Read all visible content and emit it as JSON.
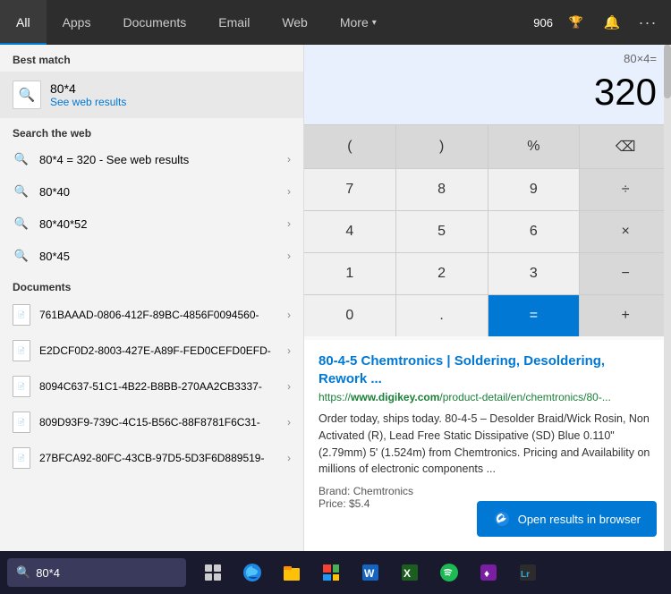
{
  "nav": {
    "tabs": [
      {
        "label": "All",
        "active": true
      },
      {
        "label": "Apps"
      },
      {
        "label": "Documents"
      },
      {
        "label": "Email"
      },
      {
        "label": "Web"
      },
      {
        "label": "More",
        "chevron": true
      }
    ],
    "score": "906",
    "trophy_icon": "🏆",
    "bell_icon": "🔔",
    "more_icon": "⋯"
  },
  "left": {
    "best_match_label": "Best match",
    "best_match": {
      "title": "80*4",
      "sub": "See web results"
    },
    "search_web_label": "Search the web",
    "web_items": [
      {
        "text": "80*4 = 320",
        "suffix": "- See web results"
      },
      {
        "text": "80*40"
      },
      {
        "text": "80*40*52"
      },
      {
        "text": "80*45"
      }
    ],
    "documents_label": "Documents",
    "docs": [
      {
        "text": "761BAAAD-0806-412F-89BC-4856F0094560-"
      },
      {
        "text": "E2DCF0D2-8003-427E-A89F-FED0CEFD0EFD-"
      },
      {
        "text": "8094C637-51C1-4B22-B8BB-270AA2CB3337-"
      },
      {
        "text": "809D93F9-739C-4C15-B56C-88F8781F6C31-"
      },
      {
        "text": "27BFCA92-80FC-43CB-97D5-5D3F6D889519-"
      }
    ]
  },
  "calculator": {
    "expression": "80×4=",
    "result": "320",
    "buttons": [
      {
        "label": "(",
        "type": "dark"
      },
      {
        "label": ")",
        "type": "dark"
      },
      {
        "label": "%",
        "type": "dark"
      },
      {
        "label": "⌫",
        "type": "dark"
      },
      {
        "label": "7",
        "type": "light"
      },
      {
        "label": "8",
        "type": "light"
      },
      {
        "label": "9",
        "type": "light"
      },
      {
        "label": "÷",
        "type": "dark"
      },
      {
        "label": "4",
        "type": "light"
      },
      {
        "label": "5",
        "type": "light"
      },
      {
        "label": "6",
        "type": "light"
      },
      {
        "label": "×",
        "type": "dark"
      },
      {
        "label": "1",
        "type": "light"
      },
      {
        "label": "2",
        "type": "light"
      },
      {
        "label": "3",
        "type": "light"
      },
      {
        "label": "−",
        "type": "dark"
      },
      {
        "label": "0",
        "type": "light"
      },
      {
        "label": ".",
        "type": "light"
      },
      {
        "label": "=",
        "type": "blue"
      },
      {
        "label": "+",
        "type": "dark"
      }
    ]
  },
  "web_result": {
    "title": "80-4-5 Chemtronics | Soldering, Desoldering, Rework ...",
    "url_prefix": "https://",
    "url_bold": "www.digikey.com",
    "url_suffix": "/product-detail/en/chemtronics/80-...",
    "description": "Order today, ships today. 80-4-5 – Desolder Braid/Wick Rosin, Non Activated (R), Lead Free Static Dissipative (SD) Blue 0.110\" (2.79mm) 5' (1.524m) from Chemtronics. Pricing and Availability on millions of electronic components ...",
    "brand": "Brand: Chemtronics",
    "price": "Price: $5.4",
    "open_btn": "Open results in browser"
  },
  "taskbar": {
    "search_text": "80*4",
    "search_icon": "🔍"
  }
}
